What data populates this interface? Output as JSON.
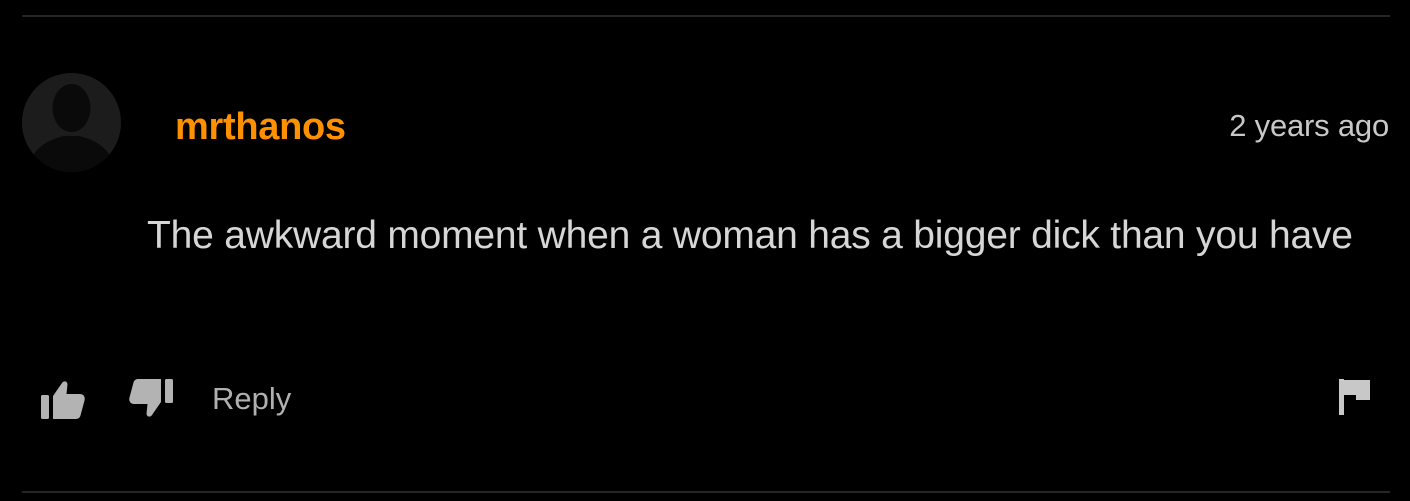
{
  "comment": {
    "username": "mrthanos",
    "timestamp": "2 years ago",
    "text": "The awkward moment when a woman has a bigger dick than you have"
  },
  "actions": {
    "like_icon": "thumbs-up-icon",
    "dislike_icon": "thumbs-down-icon",
    "reply_label": "Reply",
    "flag_icon": "flag-icon"
  },
  "colors": {
    "background": "#000000",
    "username": "#ff9000",
    "text": "#d6d6d6",
    "muted": "#b0b0b0",
    "divider": "#262626"
  }
}
